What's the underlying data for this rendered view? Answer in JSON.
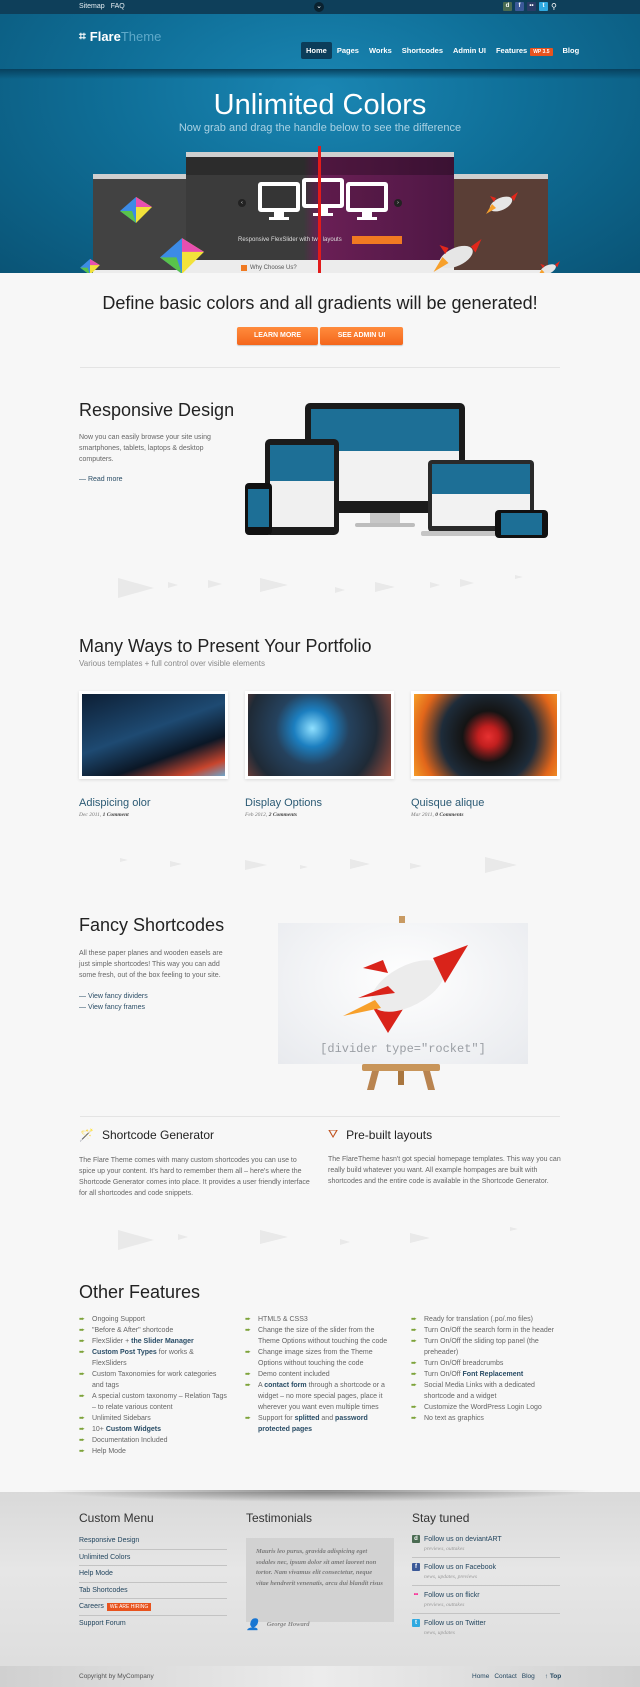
{
  "topbar": {
    "links": [
      "Sitemap",
      "FAQ"
    ],
    "toggle_icon": "chevron-down",
    "social_icons": [
      "deviantart-icon",
      "facebook-icon",
      "flickr-icon",
      "twitter-icon"
    ],
    "search_icon": "search-icon"
  },
  "header": {
    "logo_bold": "Flare",
    "logo_light": "Theme",
    "nav": [
      {
        "label": "Home",
        "active": true
      },
      {
        "label": "Pages"
      },
      {
        "label": "Works"
      },
      {
        "label": "Shortcodes"
      },
      {
        "label": "Admin UI"
      },
      {
        "label": "Features",
        "badge": "WP 3.5"
      },
      {
        "label": "Blog"
      }
    ]
  },
  "hero": {
    "title": "Unlimited Colors",
    "subtitle": "Now grab and drag the handle below to see the difference",
    "slider_caption": "Responsive FlexSlider with two layouts",
    "why_label": "Why Choose Us?"
  },
  "cta": {
    "title": "Define basic colors and all gradients will be generated!",
    "buttons": [
      "LEARN MORE",
      "SEE ADMIN UI"
    ],
    "accent": "#f4661b"
  },
  "responsive": {
    "title": "Responsive Design",
    "text": "Now you can easily browse your site using smartphones, tablets, laptops & desktop computers.",
    "link": "— Read more"
  },
  "portfolio": {
    "title": "Many Ways to Present Your Portfolio",
    "subtitle": "Various templates + full control over visible elements",
    "items": [
      {
        "title": "Adispicing olor",
        "date": "Dec 2011,",
        "comments": "1 Comment"
      },
      {
        "title": "Display Options",
        "date": "Feb 2012,",
        "comments": "2 Comments"
      },
      {
        "title": "Quisque alique",
        "date": "Mar 2011,",
        "comments": "0 Comments"
      }
    ]
  },
  "shortcodes": {
    "title": "Fancy Shortcodes",
    "text": "All these paper planes and wooden easels are just simple shortcodes! This way you can add some fresh, out of the box feeling to your site.",
    "links": [
      "— View fancy dividers",
      "— View fancy frames"
    ],
    "code": "[divider type=\"rocket\"]"
  },
  "generator": {
    "title": "Shortcode Generator",
    "text": "The Flare Theme comes with many custom shortcodes you can use to spice up your content. It's hard to remember them all – here's where the Shortcode Generator comes into place. It provides a user friendly interface for all shortcodes and code snippets."
  },
  "layouts": {
    "title": "Pre-built layouts",
    "text": "The FlareTheme hasn't got special homepage templates. This way you can really build whatever you want. All example hompages are built with shortcodes and the entire code is available in the Shortcode Generator."
  },
  "features": {
    "title": "Other Features",
    "col1": [
      "Ongoing Support",
      "\"Before & After\" shortcode",
      "FlexSlider + <b>the Slider Manager</b>",
      "<b>Custom Post Types</b> for works & FlexSliders",
      "Custom Taxonomies for work categories and tags",
      "A special custom taxonomy – Relation Tags – to relate various content",
      "Unlimited Sidebars",
      "10+ <b>Custom Widgets</b>",
      "Documentation Included",
      "Help Mode"
    ],
    "col2": [
      "HTML5 & CSS3",
      "Change the size of the slider from the Theme Options without touching the code",
      "Change image sizes from the Theme Options without touching the code",
      "Demo content included",
      "A <b>contact form</b> through a shortcode or a widget – no more special pages, place it wherever you want even multiple times",
      "Support for <b>splitted</b> and <b>password protected pages</b>"
    ],
    "col3": [
      "Ready for translation (.po/.mo files)",
      "Turn On/Off the search form in the header",
      "Turn On/Off the sliding top panel (the preheader)",
      "Turn On/Off breadcrumbs",
      "Turn On/Off <b>Font Replacement</b>",
      "Social Media Links with a dedicated shortcode and a widget",
      "Customize the WordPress Login Logo",
      "No text as graphics"
    ]
  },
  "footer": {
    "menu_title": "Custom Menu",
    "menu": [
      {
        "label": "Responsive Design"
      },
      {
        "label": "Unlimited Colors"
      },
      {
        "label": "Help Mode"
      },
      {
        "label": "Tab Shortcodes"
      },
      {
        "label": "Careers",
        "badge": "WE ARE HIRING"
      },
      {
        "label": "Support Forum"
      }
    ],
    "testimonials_title": "Testimonials",
    "quote": "Mauris leo purus, gravida adispicing eget sodales nec, ipsum dolor sit amet laoreet non tortor. Nam vivamus elit consectetur, neque vitae hendrerit venenatis, arcu dui blandit risus",
    "author": "George Howard",
    "stay_title": "Stay tuned",
    "social": [
      {
        "label": "Follow us on deviantART",
        "sub": "previews, outtakes",
        "icon": "deviantart-icon",
        "color": "#4a6b52"
      },
      {
        "label": "Follow us on Facebook",
        "sub": "news, updates, previews",
        "icon": "facebook-icon",
        "color": "#3b5998"
      },
      {
        "label": "Follow us on flickr",
        "sub": "previews, outtakes",
        "icon": "flickr-icon",
        "color": "#ff0084"
      },
      {
        "label": "Follow us on Twitter",
        "sub": "news, updates",
        "icon": "twitter-icon",
        "color": "#2fa9e0"
      }
    ],
    "copyright": "Copyright by MyCompany",
    "bottom_links": [
      "Home",
      "Contact",
      "Blog"
    ],
    "top_link": "↑ Top"
  }
}
